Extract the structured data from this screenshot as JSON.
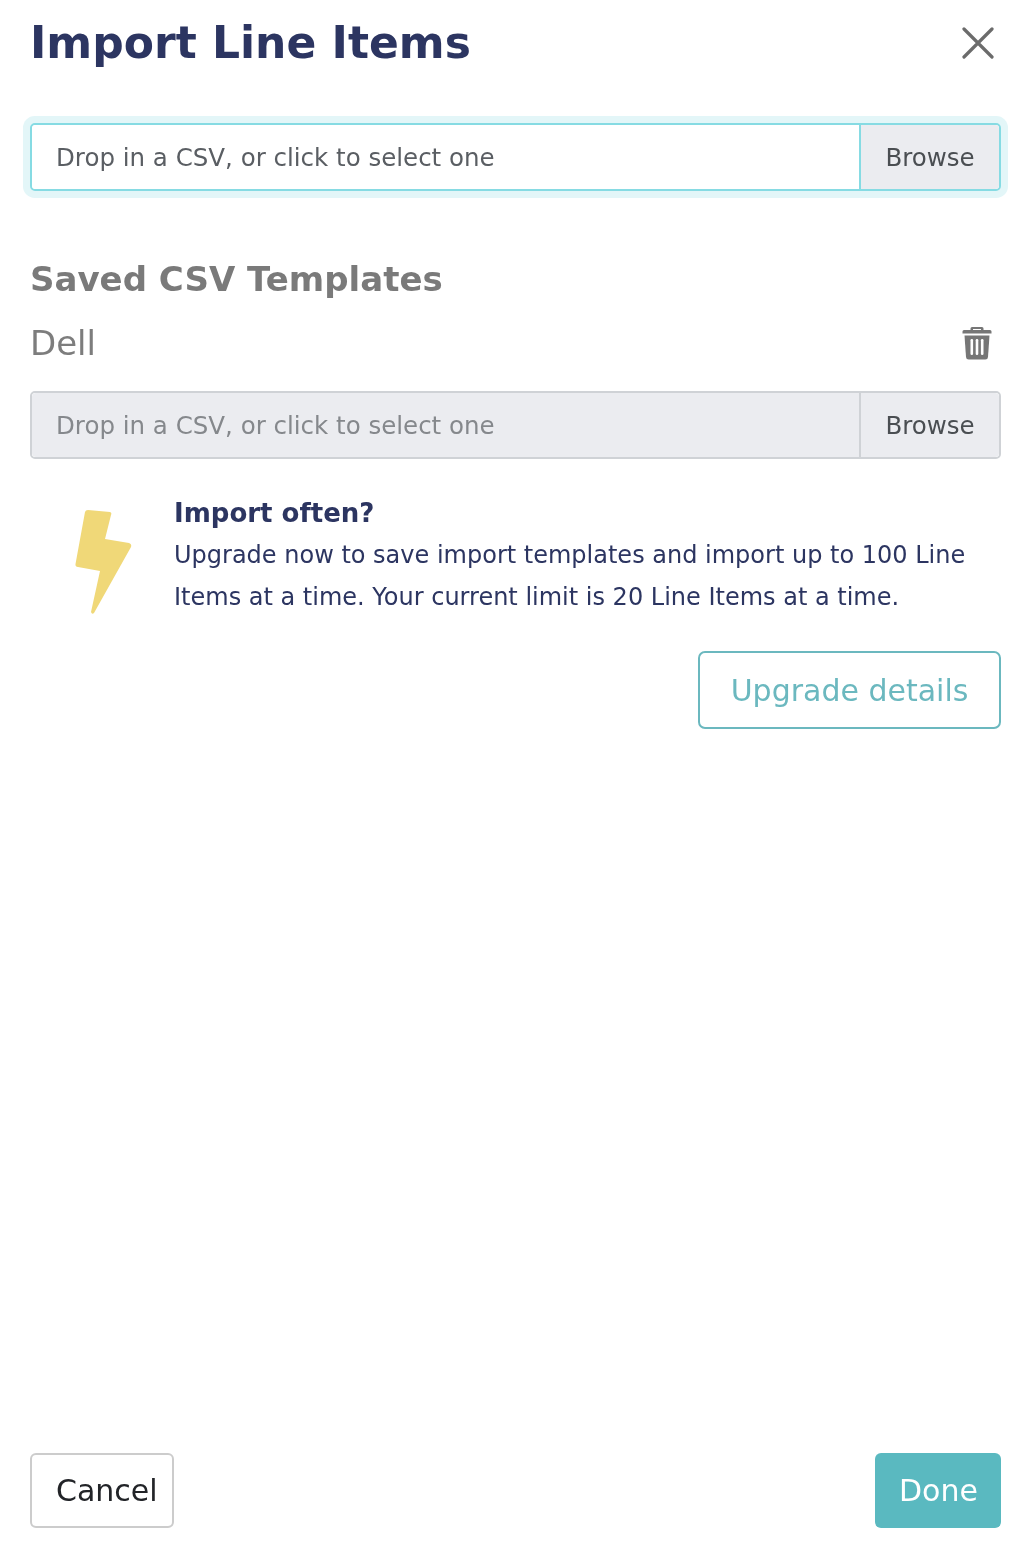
{
  "title": "Import Line Items",
  "file_input": {
    "placeholder": "Drop in a CSV, or click to select one",
    "button": "Browse",
    "focused": true,
    "disabled": false
  },
  "saved_templates": {
    "heading": "Saved CSV Templates",
    "items": [
      {
        "name": "Dell",
        "file_input": {
          "placeholder": "Drop in a CSV, or click to select one",
          "button": "Browse",
          "focused": false,
          "disabled": true
        }
      }
    ]
  },
  "upgrade_notice": {
    "heading": "Import often?",
    "text": "Upgrade now to save import templates and import up to 100 Line Items at a time. Your current limit is 20 Line Items at a time.",
    "button": "Upgrade details"
  },
  "footer": {
    "buttons": [
      {
        "label": "Cancel",
        "kind": "secondary"
      },
      {
        "label": "Done",
        "kind": "primary"
      }
    ]
  }
}
